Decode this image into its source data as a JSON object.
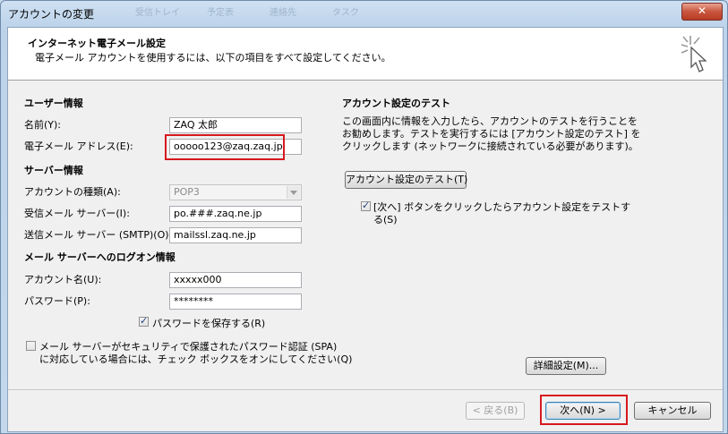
{
  "window": {
    "title": "アカウントの変更",
    "close_label": "✕",
    "ghost_items": [
      "受信トレイ",
      "予定表",
      "連絡先",
      "タスク"
    ]
  },
  "header": {
    "title": "インターネット電子メール設定",
    "subtitle": "電子メール アカウントを使用するには、以下の項目をすべて設定してください。",
    "icon": "sparkle-cursor-icon"
  },
  "user_info": {
    "section": "ユーザー情報",
    "name_label": "名前(Y):",
    "name_value": "ZAQ 太郎",
    "email_label": "電子メール アドレス(E):",
    "email_value": "ooooo123@zaq.zaq.jp"
  },
  "server_info": {
    "section": "サーバー情報",
    "account_type_label": "アカウントの種類(A):",
    "account_type_value": "POP3",
    "incoming_label": "受信メール サーバー(I):",
    "incoming_value": "po.###.zaq.ne.jp",
    "outgoing_label": "送信メール サーバー (SMTP)(O):",
    "outgoing_value": "mailssl.zaq.ne.jp"
  },
  "logon_info": {
    "section": "メール サーバーへのログオン情報",
    "account_name_label": "アカウント名(U):",
    "account_name_value": "xxxxx000",
    "password_label": "パスワード(P):",
    "password_value": "********",
    "remember_label": "パスワードを保存する(R)",
    "remember_checked": true,
    "spa_line1": "メール サーバーがセキュリティで保護されたパスワード認証 (SPA)",
    "spa_line2": "に対応している場合には、チェック ボックスをオンにしてください(Q)",
    "spa_checked": false
  },
  "test": {
    "section": "アカウント設定のテスト",
    "desc1": "この画面内に情報を入力したら、アカウントのテストを行うことを",
    "desc2": "お勧めします。テストを実行するには [アカウント設定のテスト] を",
    "desc3": "クリックします (ネットワークに接続されている必要があります)。",
    "test_button": "アカウント設定のテスト(T)",
    "auto_test_line1": "[次へ] ボタンをクリックしたらアカウント設定をテストす",
    "auto_test_line2": "る(S)",
    "auto_test_checked": true
  },
  "buttons": {
    "more_settings": "詳細設定(M)...",
    "back": "< 戻る(B)",
    "next": "次へ(N) >",
    "cancel": "キャンセル"
  },
  "colors": {
    "highlight": "#d7191e",
    "accent": "#3c7fb1"
  }
}
